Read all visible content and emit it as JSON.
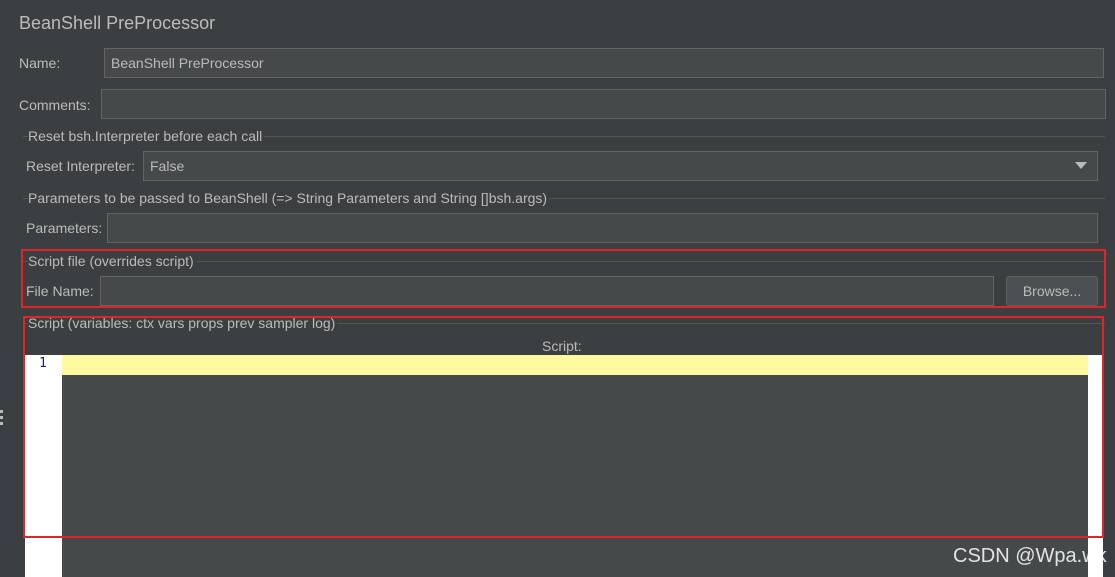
{
  "panel": {
    "title": "BeanShell PreProcessor"
  },
  "name": {
    "label": "Name:",
    "value": "BeanShell PreProcessor"
  },
  "comments": {
    "label": "Comments:",
    "value": ""
  },
  "reset_group": {
    "title": "Reset bsh.Interpreter before each call",
    "label": "Reset Interpreter:",
    "selected": "False"
  },
  "params_group": {
    "title": "Parameters to be passed to BeanShell (=> String Parameters and String []bsh.args)",
    "label": "Parameters:",
    "value": ""
  },
  "script_file_group": {
    "title": "Script file (overrides script)",
    "label": "File Name:",
    "value": "",
    "browse_label": "Browse..."
  },
  "script_group": {
    "title": "Script (variables: ctx vars props prev sampler log)",
    "editor_label": "Script:",
    "line_numbers": [
      "1"
    ]
  },
  "watermark": "CSDN @Wpa.wk",
  "colors": {
    "background": "#3c3f41",
    "field_bg": "#45494a",
    "current_line": "#fffaa0",
    "highlight_border": "#e0242a"
  }
}
